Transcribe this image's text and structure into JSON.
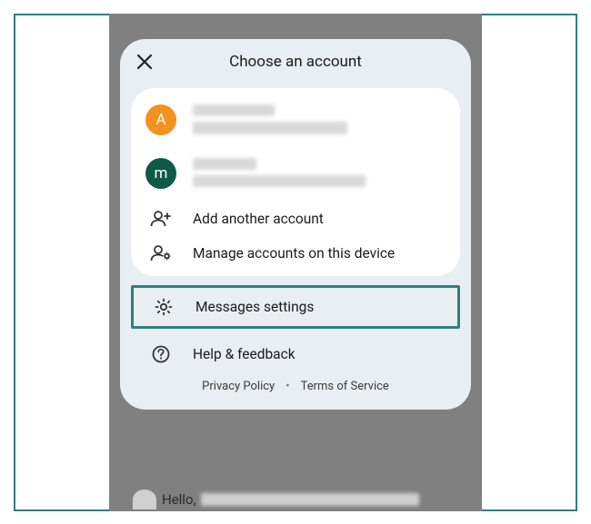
{
  "header": {
    "title": "Choose an account"
  },
  "accounts": [
    {
      "initial": "A"
    },
    {
      "initial": "m"
    }
  ],
  "actions": {
    "add_label": "Add another account",
    "manage_label": "Manage accounts on this device"
  },
  "settings_label": "Messages settings",
  "help_label": "Help & feedback",
  "footer": {
    "privacy": "Privacy Policy",
    "terms": "Terms of Service",
    "separator": "•"
  },
  "background_message_prefix": "Hello,"
}
